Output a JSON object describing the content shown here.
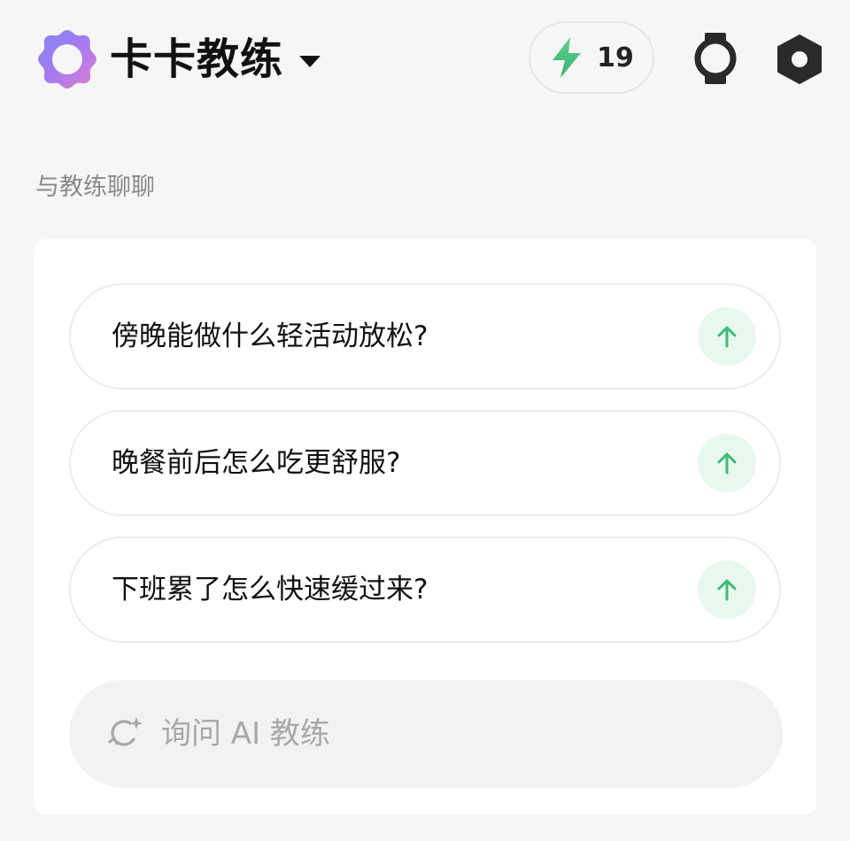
{
  "header": {
    "title": "卡卡教练",
    "energy_count": "19",
    "logo_icon": "flower-ring-logo-icon",
    "switcher_icon": "chevron-down-icon",
    "energy_icon": "lightning-bolt-icon",
    "watch_icon": "smartwatch-icon",
    "settings_icon": "hexagon-settings-icon"
  },
  "chat": {
    "section_title": "与教练聊聊",
    "suggestions": [
      {
        "text": "傍晚能做什么轻活动放松?"
      },
      {
        "text": "晚餐前后怎么吃更舒服?"
      },
      {
        "text": "下班累了怎么快速缓过来?"
      }
    ],
    "send_icon": "arrow-up-icon",
    "ask_placeholder": "询问 AI 教练",
    "ask_icon": "sparkle-refresh-icon"
  },
  "colors": {
    "background": "#f6f6f6",
    "card": "#ffffff",
    "accent_green": "#3dbb73",
    "send_bg": "#e9f8ef",
    "logo_gradient_start": "#8a7cf6",
    "logo_gradient_end": "#d07ad8"
  }
}
